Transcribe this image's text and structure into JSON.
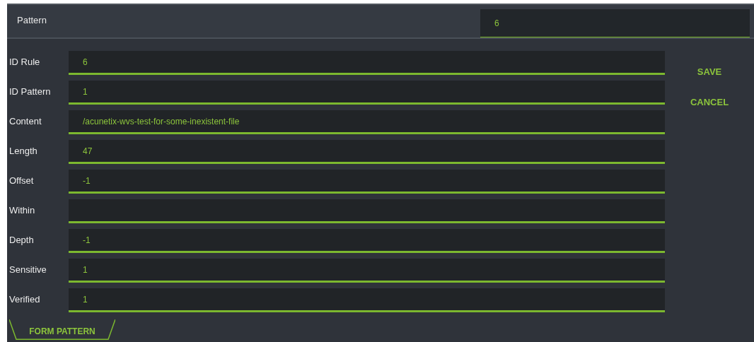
{
  "header": {
    "title": "Pattern",
    "value": "6"
  },
  "fields": [
    {
      "label": "ID Rule",
      "value": "6"
    },
    {
      "label": "ID Pattern",
      "value": "1"
    },
    {
      "label": "Content",
      "value": "/acunetix-wvs-test-for-some-inexistent-file"
    },
    {
      "label": "Length",
      "value": "47"
    },
    {
      "label": "Offset",
      "value": "-1"
    },
    {
      "label": "Within"
    },
    {
      "label": "Depth",
      "value": "-1"
    },
    {
      "label": "Sensitive",
      "value": "1"
    },
    {
      "label": "Verified",
      "value": "1"
    }
  ],
  "buttons": [
    "SAVE",
    "CANCEL"
  ],
  "tabs": [
    {
      "label": "FORM PATTERN",
      "selected": true
    }
  ]
}
